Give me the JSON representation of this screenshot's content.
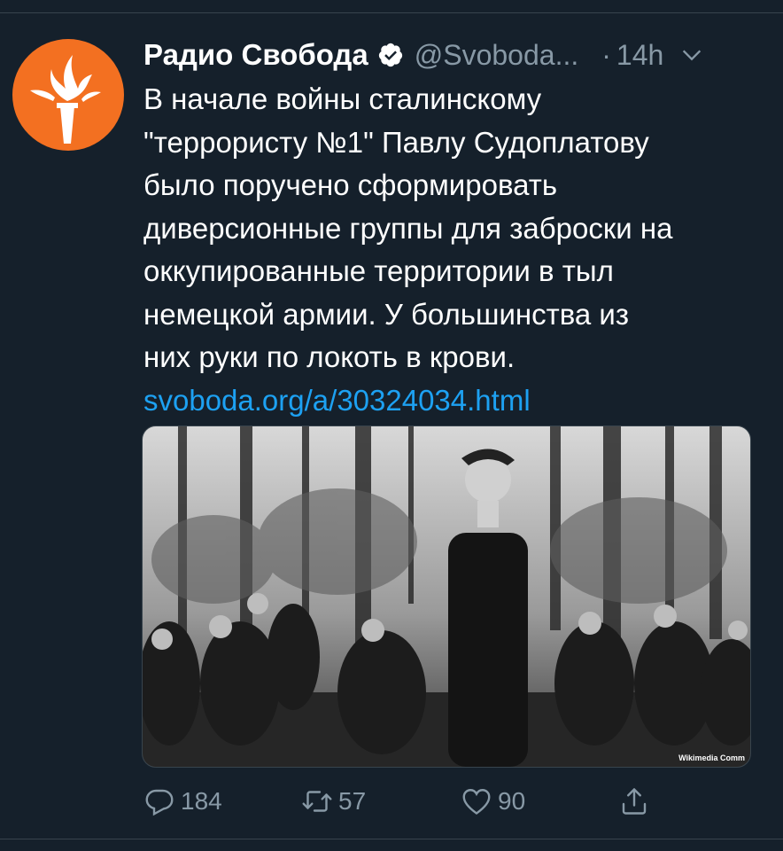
{
  "tweet": {
    "author_name": "Радио Свобода",
    "handle": "@Svoboda...",
    "dot": "·",
    "time": "14h",
    "text_lines": [
      "В начале войны сталинскому",
      "\"террористу №1\" Павлу Судоплатову",
      "было поручено сформировать",
      "диверсионные группы для заброски на",
      "оккупированные территории в тыл",
      "немецкой армии. У большинства из",
      "них руки по локоть в крови."
    ],
    "link": "svoboda.org/a/30324034.html",
    "image_watermark": "Wikimedia Comm"
  },
  "actions": {
    "replies": "184",
    "retweets": "57",
    "likes": "90"
  },
  "colors": {
    "background": "#15202b",
    "accent_link": "#1da1f2",
    "muted": "#8899a6",
    "avatar_orange": "#f37021"
  },
  "icons": {
    "avatar": "torch-logo",
    "verified": "verified-badge-icon",
    "menu": "chevron-down-icon",
    "reply": "reply-icon",
    "retweet": "retweet-icon",
    "like": "heart-icon",
    "share": "share-icon"
  }
}
